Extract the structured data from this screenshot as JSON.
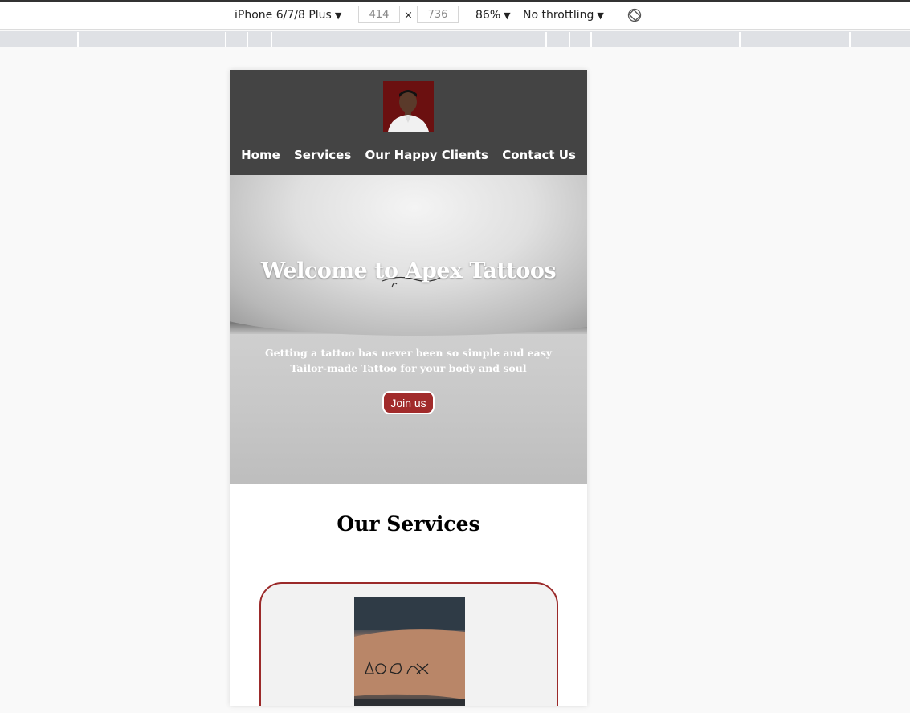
{
  "devtools": {
    "device_label": "iPhone 6/7/8 Plus",
    "width_value": "414",
    "times_sign": "×",
    "height_value": "736",
    "zoom_label": "86%",
    "throttle_label": "No throttling",
    "caret": "▼"
  },
  "site": {
    "nav": {
      "home": "Home",
      "services": "Services",
      "clients": "Our Happy Clients",
      "contact": "Contact Us"
    },
    "hero": {
      "title": "Welcome to Apex Tattoos",
      "line1": "Getting a tattoo has never been so simple and easy",
      "line2": "Tailor-made Tattoo for your body and soul",
      "button": "Join us"
    },
    "services_heading": "Our Services"
  },
  "colors": {
    "header_bg": "#444444",
    "accent": "#a12b2b",
    "card_bg": "#f2f2f2"
  },
  "icons": {
    "rotate": "rotate-device-icon",
    "caret": "chevron-down-icon"
  }
}
